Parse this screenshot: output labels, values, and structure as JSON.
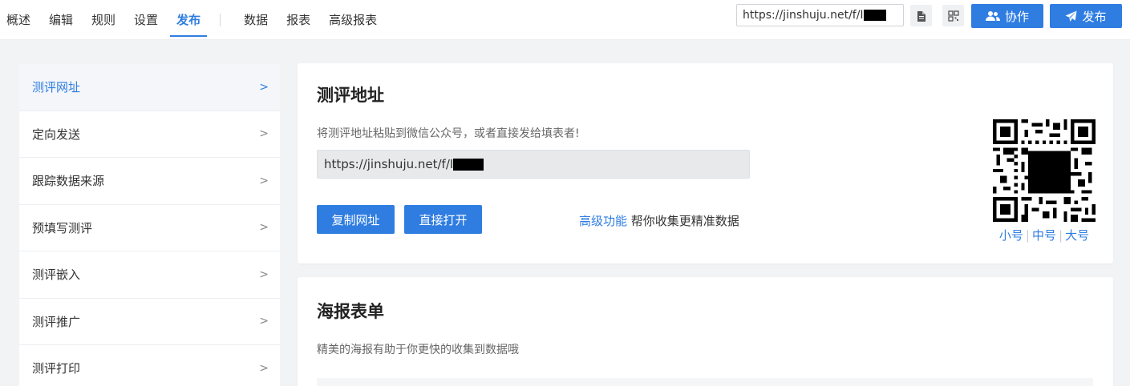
{
  "nav": {
    "items": [
      "概述",
      "编辑",
      "规则",
      "设置",
      "发布",
      "数据",
      "报表",
      "高级报表"
    ],
    "active": "发布"
  },
  "header": {
    "url": "https://jinshuju.net/f/I",
    "copy_icon": "copy-document-icon",
    "qr_icon": "qr-code-icon",
    "collab_label": "协作",
    "collab_icon": "users-icon",
    "publish_label": "发布",
    "publish_icon": "paper-plane-icon"
  },
  "sidebar": {
    "items": [
      {
        "label": "测评网址"
      },
      {
        "label": "定向发送"
      },
      {
        "label": "跟踪数据来源"
      },
      {
        "label": "预填写测评"
      },
      {
        "label": "测评嵌入"
      },
      {
        "label": "测评推广"
      },
      {
        "label": "测评打印"
      }
    ],
    "active": "测评网址",
    "chevron": ">"
  },
  "address_card": {
    "title": "测评地址",
    "description": "将测评地址粘贴到微信公众号，或者直接发给填表者!",
    "url": "https://jinshuju.net/f/I",
    "copy_button": "复制网址",
    "open_button": "直接打开",
    "advanced_link": "高级功能",
    "advanced_text": "帮你收集更精准数据",
    "qr_sizes": [
      "小号",
      "中号",
      "大号"
    ],
    "qr_separator": "|"
  },
  "poster_card": {
    "title": "海报表单",
    "description": "精美的海报有助于你更快的收集到数据哦"
  },
  "colors": {
    "accent": "#2f7de1",
    "background": "#f2f3f5",
    "field": "#e8e9eb"
  }
}
